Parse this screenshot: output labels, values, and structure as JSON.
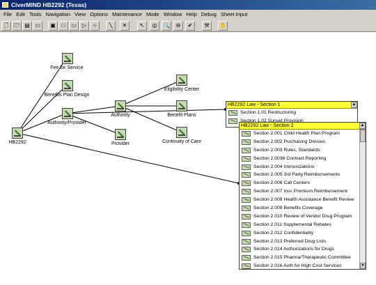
{
  "window": {
    "title": "CiverMIND HB2292 (Texas)"
  },
  "menu": [
    "File",
    "Edit",
    "Tools",
    "Navigation",
    "View",
    "Options",
    "Maintenance",
    "Mode",
    "Window",
    "Help",
    "Debug",
    "Sheet Input"
  ],
  "toolbar": [
    {
      "name": "new-icon",
      "glyph": "🗋"
    },
    {
      "name": "open-icon",
      "glyph": "🗁"
    },
    {
      "name": "save-icon",
      "glyph": "▤"
    },
    {
      "name": "folder-icon",
      "glyph": "▭"
    },
    {
      "name": "frame-icon",
      "glyph": "▣"
    },
    {
      "name": "square-icon",
      "glyph": "□"
    },
    {
      "name": "rect-icon",
      "glyph": "▭"
    },
    {
      "name": "arrow-shape-icon",
      "glyph": "▷"
    },
    {
      "name": "circle-icon",
      "glyph": "○"
    },
    {
      "name": "link-icon",
      "glyph": "╲"
    },
    {
      "name": "cross-link-icon",
      "glyph": "✕"
    },
    {
      "name": "pointer-icon",
      "glyph": "↖"
    },
    {
      "name": "globe-icon",
      "glyph": "◎"
    },
    {
      "name": "zoom-icon",
      "glyph": "🔍"
    },
    {
      "name": "zoom-out-icon",
      "glyph": "⊖"
    },
    {
      "name": "check-icon",
      "glyph": "✔"
    },
    {
      "name": "tool-icon",
      "glyph": "⚒"
    },
    {
      "name": "hand-icon",
      "glyph": "✋"
    }
  ],
  "nodes": [
    {
      "id": "fee",
      "label": "Fee for Service"
    },
    {
      "id": "benefits-design",
      "label": "Benefits Plan Design"
    },
    {
      "id": "authority-provider",
      "label": "Authority/Provider"
    },
    {
      "id": "hb2292",
      "label": "HB2292"
    },
    {
      "id": "authority",
      "label": "Authority"
    },
    {
      "id": "provider",
      "label": "Provider"
    },
    {
      "id": "eligibility",
      "label": "Eligibility Center"
    },
    {
      "id": "benefit-plans",
      "label": "Benefit Plans"
    },
    {
      "id": "continuity",
      "label": "Continuity of Care"
    }
  ],
  "section1": {
    "title": "HB2292 Law - Section 1",
    "items": [
      "Section 1.01 Restructuring",
      "Section 1.02 Sunset Provision"
    ]
  },
  "section2": {
    "title": "HB2292 Law - Section 2",
    "items": [
      "Section 2.001 Child Health Plan Program",
      "Section 2.002 Purchasing Division",
      "Section 2.003 Rules, Standards",
      "Section 2.0036 Contract Reporting",
      "Section 2.004 Immunizations",
      "Section 2.005 3rd Party Reimbursements",
      "Section 2.006 Call Centers",
      "Section 2.007 Insc Premium Reimbursement",
      "Section 2.008 Health Assistance Benefit Review",
      "Section 2.009 Benefits Coverage",
      "Section 2.010 Review of Vendor Drug Program",
      "Section 2.011 Supplemental Rebates",
      "Section 2.012 Confidentiality",
      "Section 2.013 Preferred Drug Lists",
      "Section 2.014 Authorizations for Drugs",
      "Section 2.015 Pharma/Therapeutic Committee",
      "Section 2.016 Auth for High Cost Services"
    ]
  }
}
